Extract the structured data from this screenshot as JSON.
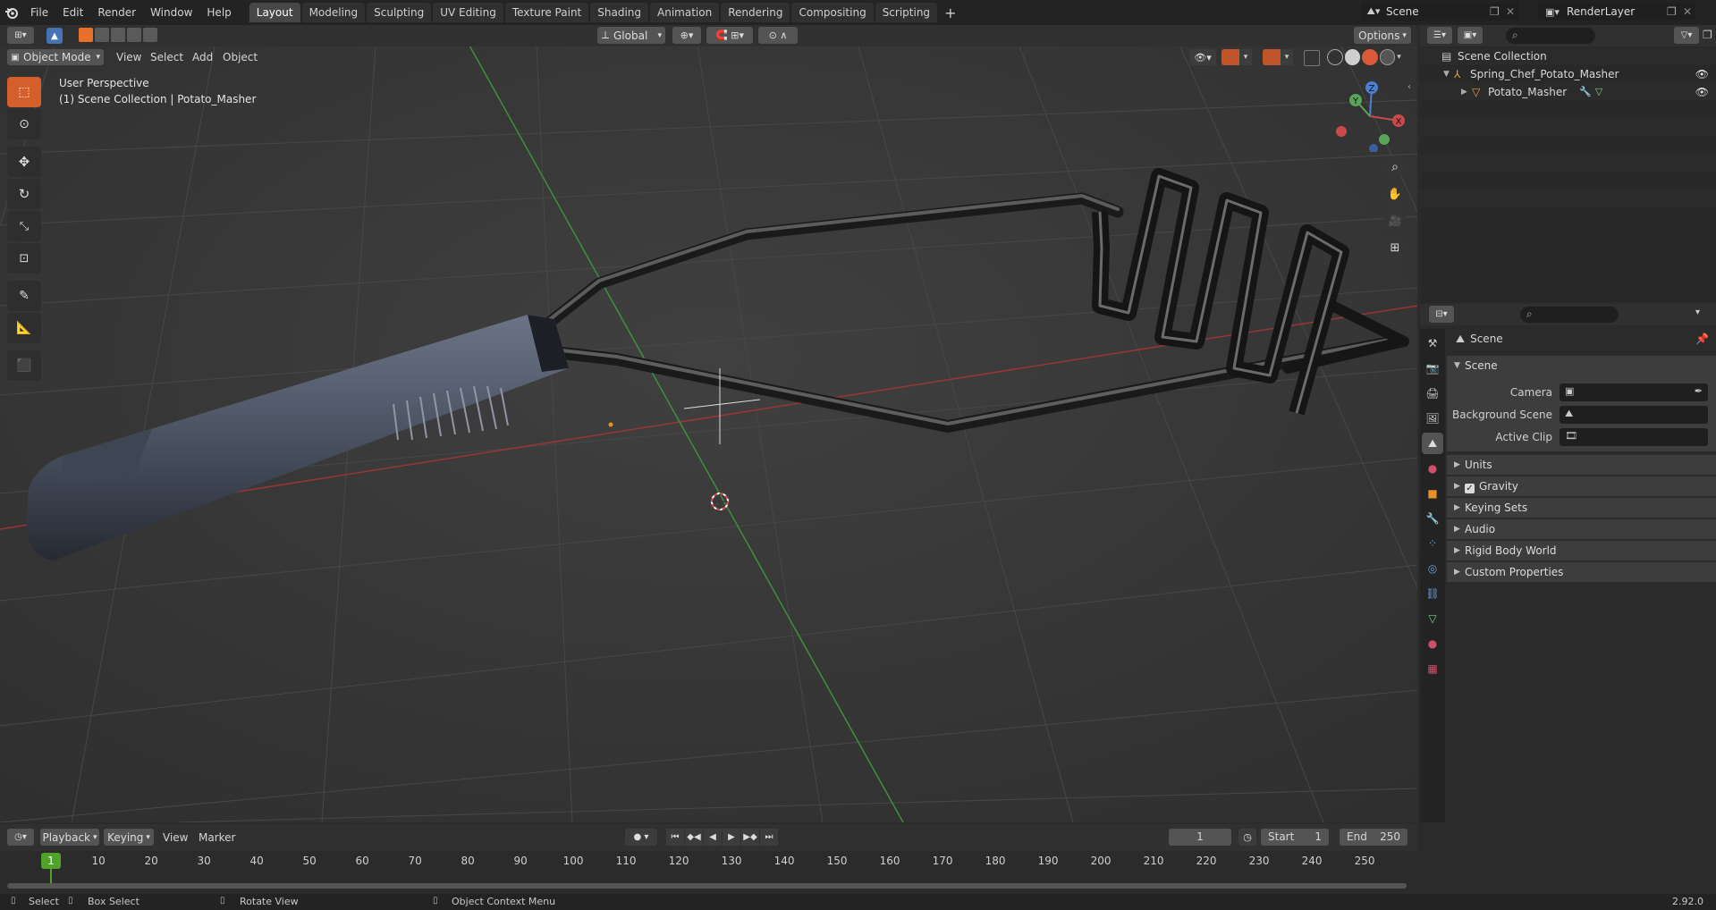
{
  "menu": [
    "File",
    "Edit",
    "Render",
    "Window",
    "Help"
  ],
  "workspaces": [
    "Layout",
    "Modeling",
    "Sculpting",
    "UV Editing",
    "Texture Paint",
    "Shading",
    "Animation",
    "Rendering",
    "Compositing",
    "Scripting"
  ],
  "active_workspace": "Layout",
  "scene_name": "Scene",
  "render_layer": "RenderLayer",
  "viewport_header": {
    "mode": "Object Mode",
    "menus": [
      "View",
      "Select",
      "Add",
      "Object"
    ],
    "orientation": "Global",
    "options": "Options"
  },
  "viewport_info": {
    "line1": "User Perspective",
    "line2": "(1) Scene Collection | Potato_Masher"
  },
  "gizmo": {
    "z": "Z",
    "y": "Y",
    "x": "X"
  },
  "outliner": {
    "root": "Scene Collection",
    "collection": "Spring_Chef_Potato_Masher",
    "object": "Potato_Masher"
  },
  "properties": {
    "context": "Scene",
    "panel_title": "Scene",
    "camera_label": "Camera",
    "background_label": "Background Scene",
    "clip_label": "Active Clip",
    "collapsed": [
      "Units",
      "Gravity",
      "Keying Sets",
      "Audio",
      "Rigid Body World",
      "Custom Properties"
    ]
  },
  "timeline": {
    "menus": [
      "Playback",
      "Keying",
      "View",
      "Marker"
    ],
    "current_frame": "1",
    "start_label": "Start",
    "start": "1",
    "end_label": "End",
    "end": "250",
    "ticks": [
      "10",
      "20",
      "30",
      "40",
      "50",
      "60",
      "70",
      "80",
      "90",
      "100",
      "110",
      "120",
      "130",
      "140",
      "150",
      "160",
      "170",
      "180",
      "190",
      "200",
      "210",
      "220",
      "230",
      "240",
      "250"
    ],
    "marker": "1"
  },
  "statusbar": {
    "select": "Select",
    "box_select": "Box Select",
    "rotate": "Rotate View",
    "context_menu": "Object Context Menu",
    "version": "2.92.0"
  },
  "colors": {
    "accent": "#4772b3",
    "select_orange": "#e8702a",
    "grid_red": "#9a3535",
    "grid_green": "#3f8f3f",
    "frame_green": "#4fa32a"
  }
}
